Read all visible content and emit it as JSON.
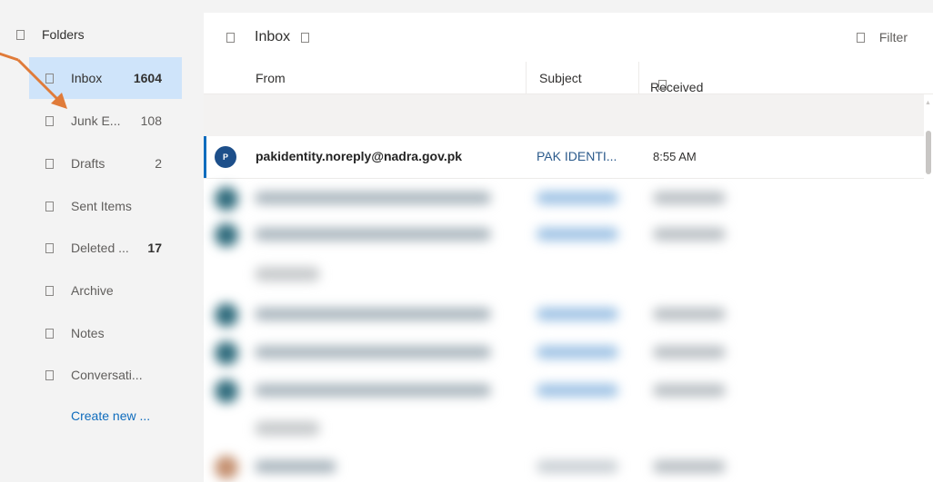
{
  "sidebar": {
    "header": "Folders",
    "items": [
      {
        "label": "Inbox",
        "count": "1604",
        "selected": true,
        "bold_count": true
      },
      {
        "label": "Junk E...",
        "count": "108",
        "selected": false,
        "bold_count": false
      },
      {
        "label": "Drafts",
        "count": "2",
        "selected": false,
        "bold_count": false
      },
      {
        "label": "Sent Items",
        "count": "",
        "selected": false,
        "bold_count": false
      },
      {
        "label": "Deleted ...",
        "count": "17",
        "selected": false,
        "bold_count": true
      },
      {
        "label": "Archive",
        "count": "",
        "selected": false,
        "bold_count": false
      },
      {
        "label": "Notes",
        "count": "",
        "selected": false,
        "bold_count": false
      },
      {
        "label": "Conversati...",
        "count": "",
        "selected": false,
        "bold_count": false
      }
    ],
    "create_new": "Create new ..."
  },
  "main": {
    "title": "Inbox",
    "filter_label": "Filter",
    "columns": {
      "from": "From",
      "subject": "Subject",
      "received": "Received"
    },
    "emails": [
      {
        "avatar_initial": "P",
        "sender": "pakidentity.noreply@nadra.gov.pk",
        "subject": "PAK IDENTI...",
        "time": "8:55 AM",
        "unread": true
      }
    ]
  },
  "colors": {
    "accent": "#0f6cbd",
    "selected_folder_bg": "#cfe4fa",
    "avatar_bg": "#1d4f8a",
    "annotation_arrow": "#e07b39"
  }
}
